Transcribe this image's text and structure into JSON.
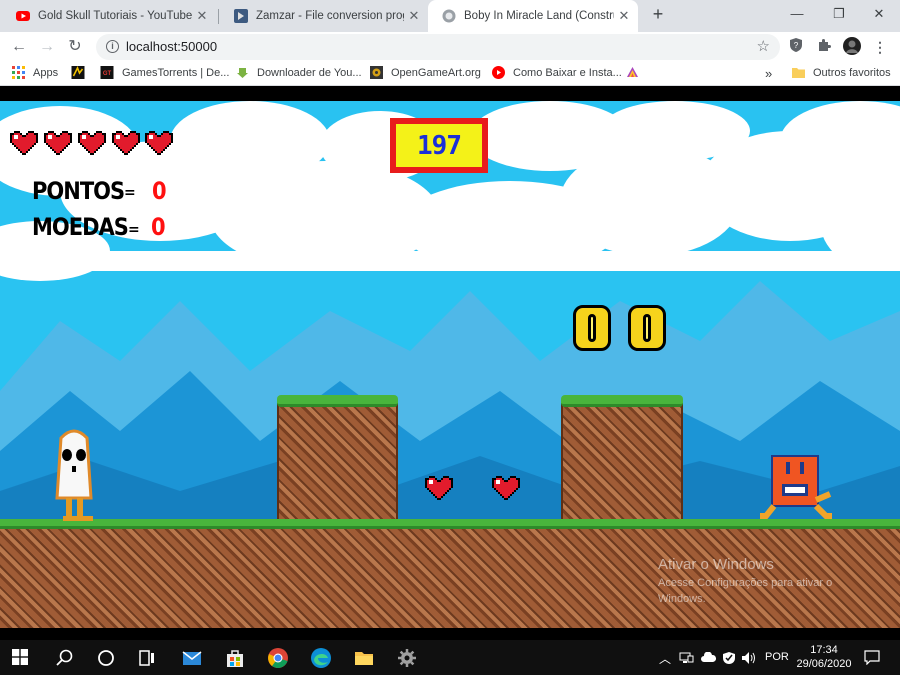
{
  "browser": {
    "tabs": [
      {
        "title": "Gold Skull Tutoriais - YouTube",
        "icon": "youtube-icon",
        "active": false
      },
      {
        "title": "Zamzar - File conversion progres",
        "icon": "zamzar-icon",
        "active": false
      },
      {
        "title": "Boby In Miracle Land (Construct",
        "icon": "construct-icon",
        "active": true
      }
    ],
    "new_tab_label": "+",
    "url": "localhost:50000",
    "bookmarks": [
      {
        "label": "Apps",
        "icon": "apps-grid-icon"
      },
      {
        "label": "",
        "icon": "bookmark-logo-icon"
      },
      {
        "label": "GamesTorrents | De...",
        "icon": "gamestorrents-icon"
      },
      {
        "label": "Downloader de You...",
        "icon": "android-download-icon"
      },
      {
        "label": "OpenGameArt.org",
        "icon": "opengameart-icon"
      },
      {
        "label": "Como Baixar e Insta...",
        "icon": "youtube-icon"
      },
      {
        "label": "",
        "icon": "colorful-bookmark-icon"
      }
    ],
    "bookmarks_overflow": "»",
    "other_bookmarks": "Outros favoritos"
  },
  "game": {
    "lives": 5,
    "timer": "197",
    "hud": {
      "points_label": "PONTOS",
      "points_eq": "=",
      "points_value": "0",
      "coins_label": "MOEDAS",
      "coins_eq": "=",
      "coins_value": "0"
    },
    "coins_on_screen": 2,
    "heart_pickups": 2
  },
  "watermark": {
    "title": "Ativar o Windows",
    "line1": "Acesse Configurações para ativar o",
    "line2": "Windows."
  },
  "taskbar": {
    "language": "POR",
    "time": "17:34",
    "date": "29/06/2020",
    "colors": {
      "bar": "#101010",
      "accent": "#7aa7e6"
    }
  }
}
